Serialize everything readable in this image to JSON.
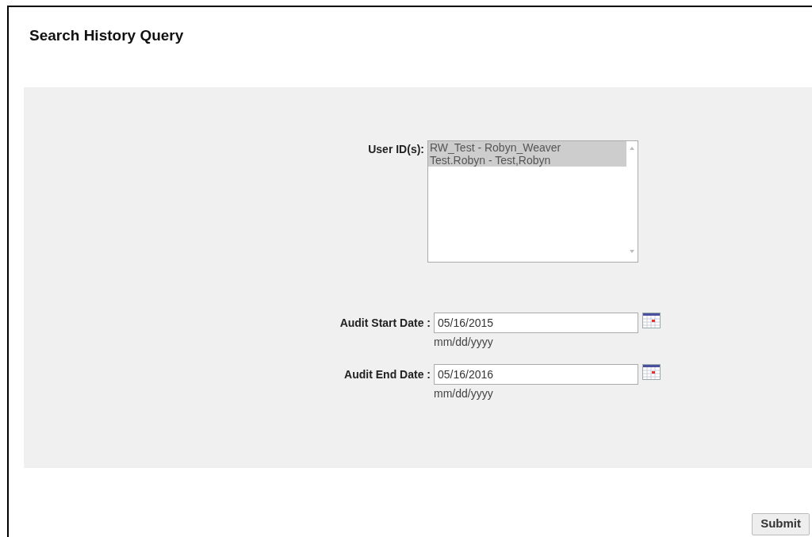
{
  "title": "Search History Query",
  "user_ids": {
    "label": "User ID(s):",
    "options": [
      {
        "text": "RW_Test - Robyn_Weaver",
        "selected": true
      },
      {
        "text": "Test.Robyn - Test,Robyn",
        "selected": true
      }
    ]
  },
  "dates": [
    {
      "label": "Audit Start Date :",
      "value": "05/16/2015",
      "hint": "mm/dd/yyyy"
    },
    {
      "label": "Audit End Date :",
      "value": "05/16/2016",
      "hint": "mm/dd/yyyy"
    }
  ],
  "submit": "Submit"
}
